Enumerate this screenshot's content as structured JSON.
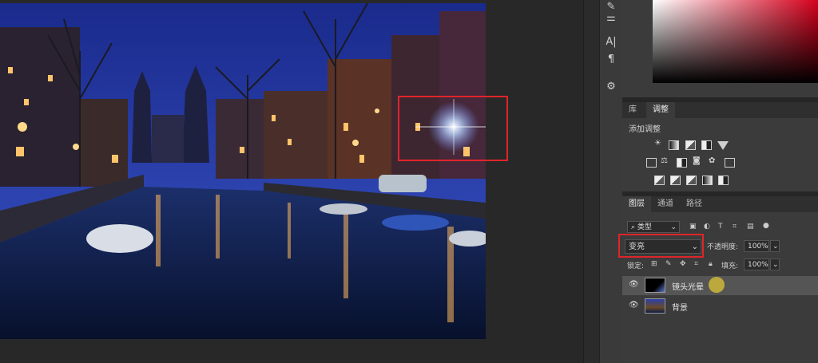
{
  "canvas": {
    "description_colors": {
      "sky": "#1f2f8a",
      "water": "#0e1c44",
      "lights": "#ffc46b"
    }
  },
  "panels": {
    "tabs_top": [
      {
        "label": "库"
      },
      {
        "label": "调整"
      }
    ],
    "adjustments_title": "添加调整",
    "layers_tabs": [
      {
        "label": "图层"
      },
      {
        "label": "通道"
      },
      {
        "label": "路径"
      }
    ],
    "filter_kind": "类型",
    "blend_mode": "变亮",
    "opacity_label": "不透明度:",
    "opacity_value": "100%",
    "lock_label": "锁定:",
    "fill_label": "填充:",
    "fill_value": "100%",
    "layers": [
      {
        "name": "镜头光晕",
        "selected": true
      },
      {
        "name": "背景",
        "selected": false
      }
    ]
  },
  "tools": [
    {
      "icon": "brush-icon"
    },
    {
      "icon": "sliders-icon"
    },
    {
      "icon": "character-icon",
      "glyph": "A|"
    },
    {
      "icon": "paragraph-icon",
      "glyph": "¶"
    },
    {
      "icon": "gear-icon"
    }
  ],
  "colors": {
    "highlight_red": "#e0242a",
    "panel": "#3b3b3b",
    "dark": "#282828"
  }
}
